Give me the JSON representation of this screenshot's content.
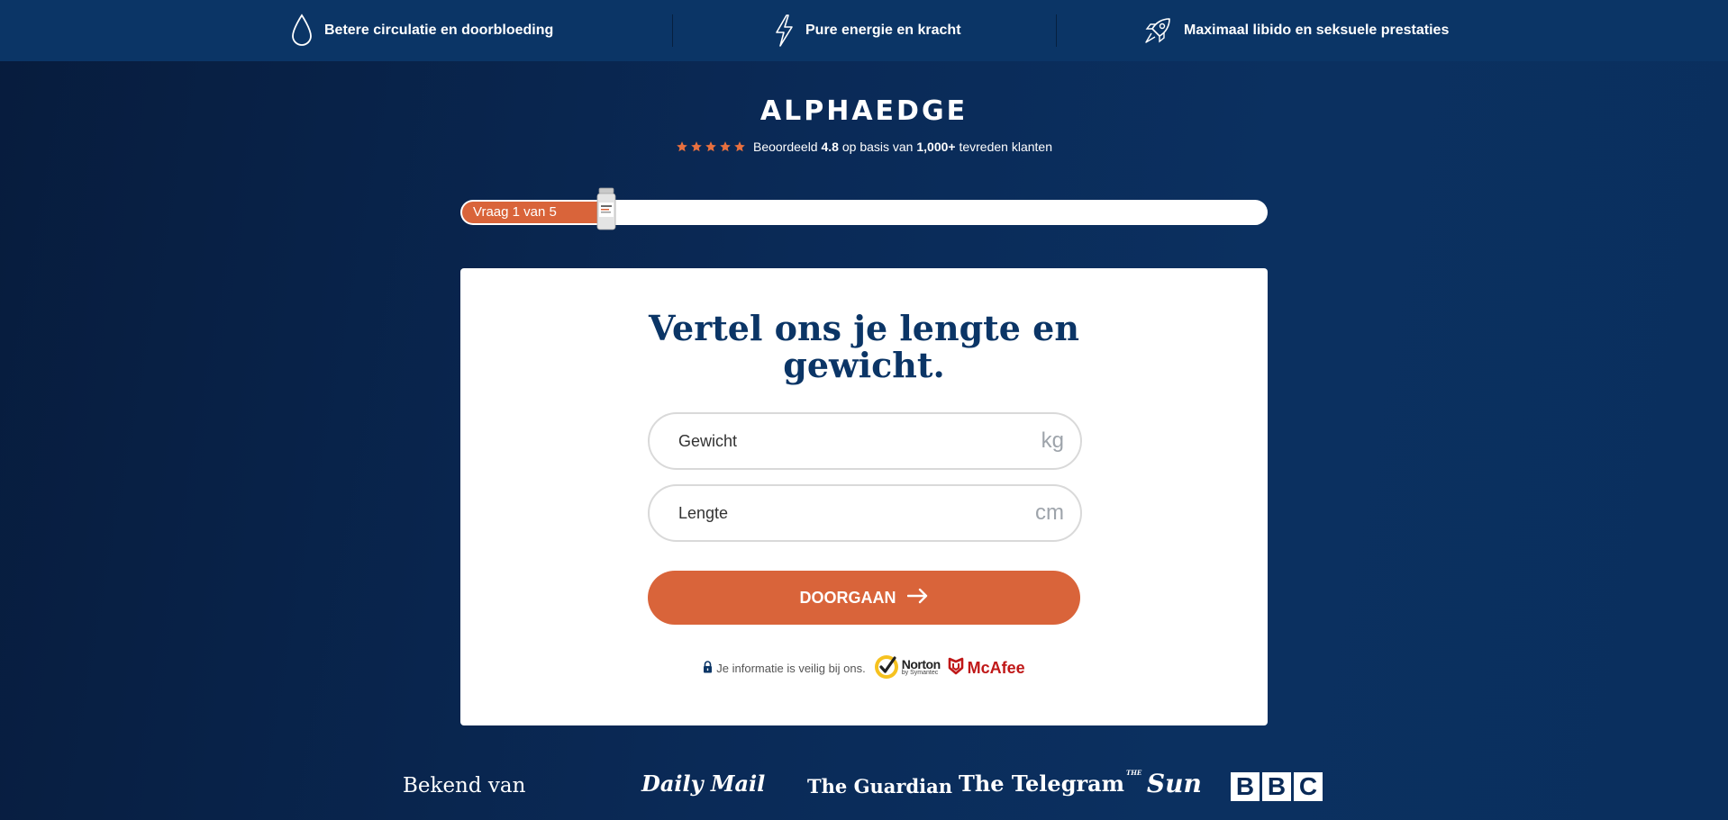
{
  "topbar": {
    "benefits": [
      {
        "label": "Betere circulatie en doorbloeding",
        "icon": "water-drop-icon"
      },
      {
        "label": "Pure energie en kracht",
        "icon": "lightning-icon"
      },
      {
        "label": "Maximaal libido en seksuele prestaties",
        "icon": "rocket-icon"
      }
    ]
  },
  "brand": {
    "logo": "ALPHAEDGE"
  },
  "rating": {
    "stars": 5,
    "prefix": "Beoordeeld",
    "score": "4.8",
    "middle": "op basis van",
    "count": "1,000+",
    "suffix": "tevreden klanten",
    "star_color": "#e8703f"
  },
  "progress": {
    "label": "Vraag 1 van 5",
    "current": 1,
    "total": 5,
    "fill_color": "#d9643a"
  },
  "form": {
    "title_line1": "Vertel ons je lengte en",
    "title_line2": "gewicht.",
    "weight": {
      "placeholder": "Gewicht",
      "value": "",
      "unit": "kg"
    },
    "height": {
      "placeholder": "Lengte",
      "value": "",
      "unit": "cm"
    },
    "submit_label": "DOORGAAN",
    "submit_color": "#d9643a"
  },
  "security": {
    "text": "Je informatie is veilig bij ons.",
    "norton_name": "Norton",
    "norton_sub": "by Symantec",
    "mcafee": "McAfee"
  },
  "press": {
    "label": "Bekend van",
    "logos": [
      "Daily Mail",
      "The Guardian",
      "The Telegram",
      "Sun",
      "BBC"
    ],
    "sun_small": "THE",
    "bbc_letters": [
      "B",
      "B",
      "C"
    ]
  },
  "colors": {
    "navy": "#0b3566",
    "accent": "#d9643a"
  }
}
